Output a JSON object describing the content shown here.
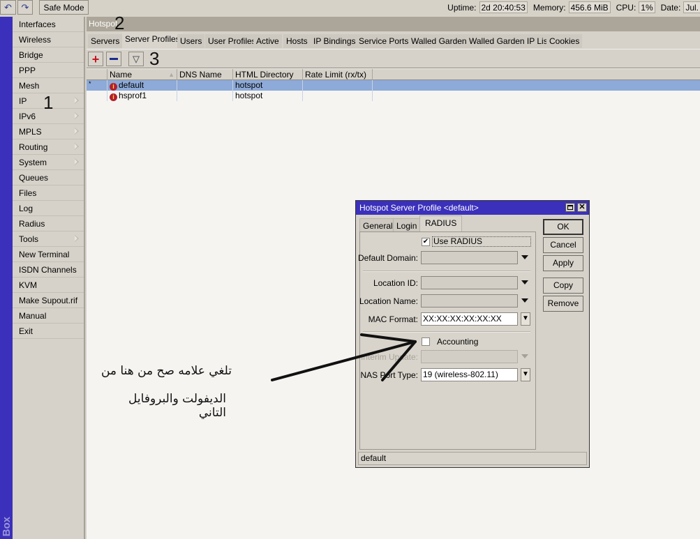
{
  "toolbar": {
    "undo_icon": "undo-icon",
    "redo_icon": "redo-icon",
    "safe_mode_label": "Safe Mode"
  },
  "status": {
    "uptime_label": "Uptime:",
    "uptime_value": "2d 20:40:53",
    "memory_label": "Memory:",
    "memory_value": "456.6 MiB",
    "cpu_label": "CPU:",
    "cpu_value": "1%",
    "date_label": "Date:",
    "date_value": "Jul."
  },
  "brand_strip_text": "Box",
  "sidebar": {
    "items": [
      {
        "label": "Interfaces",
        "submenu": false
      },
      {
        "label": "Wireless",
        "submenu": false
      },
      {
        "label": "Bridge",
        "submenu": false
      },
      {
        "label": "PPP",
        "submenu": false
      },
      {
        "label": "Mesh",
        "submenu": false
      },
      {
        "label": "IP",
        "submenu": true
      },
      {
        "label": "IPv6",
        "submenu": true
      },
      {
        "label": "MPLS",
        "submenu": true
      },
      {
        "label": "Routing",
        "submenu": true
      },
      {
        "label": "System",
        "submenu": true
      },
      {
        "label": "Queues",
        "submenu": false
      },
      {
        "label": "Files",
        "submenu": false
      },
      {
        "label": "Log",
        "submenu": false
      },
      {
        "label": "Radius",
        "submenu": false
      },
      {
        "label": "Tools",
        "submenu": true
      },
      {
        "label": "New Terminal",
        "submenu": false
      },
      {
        "label": "ISDN Channels",
        "submenu": false
      },
      {
        "label": "KVM",
        "submenu": false
      },
      {
        "label": "Make Supout.rif",
        "submenu": false
      },
      {
        "label": "Manual",
        "submenu": false
      },
      {
        "label": "Exit",
        "submenu": false
      }
    ]
  },
  "annotations": {
    "one": "1",
    "two": "2",
    "three": "3"
  },
  "window": {
    "title": "Hotspot",
    "tabs": [
      "Servers",
      "Server Profiles",
      "Users",
      "User Profiles",
      "Active",
      "Hosts",
      "IP Bindings",
      "Service Ports",
      "Walled Garden",
      "Walled Garden IP List",
      "Cookies"
    ],
    "active_tab": "Server Profiles",
    "tools": {
      "add": "add-icon",
      "remove": "remove-icon",
      "filter": "filter-icon"
    },
    "table": {
      "columns": [
        "Name",
        "DNS Name",
        "HTML Directory",
        "Rate Limit (rx/tx)"
      ],
      "rows": [
        {
          "flag": "*",
          "name": "default",
          "dns_name": "",
          "html_directory": "hotspot",
          "rate_limit": "",
          "selected": true
        },
        {
          "flag": "",
          "name": "hsprof1",
          "dns_name": "",
          "html_directory": "hotspot",
          "rate_limit": "",
          "selected": false
        }
      ]
    }
  },
  "dialog": {
    "title": "Hotspot Server Profile <default>",
    "tabs": [
      "General",
      "Login",
      "RADIUS"
    ],
    "active_tab": "RADIUS",
    "use_radius_label": "Use RADIUS",
    "use_radius_checked": true,
    "default_domain_label": "Default Domain:",
    "default_domain_value": "",
    "location_id_label": "Location ID:",
    "location_id_value": "",
    "location_name_label": "Location Name:",
    "location_name_value": "",
    "mac_format_label": "MAC Format:",
    "mac_format_value": "XX:XX:XX:XX:XX:XX",
    "accounting_label": "Accounting",
    "accounting_checked": false,
    "interim_update_label": "Interim Update:",
    "interim_update_value": "",
    "nas_port_type_label": "NAS Port Type:",
    "nas_port_type_value": "19 (wireless-802.11)",
    "buttons": {
      "ok": "OK",
      "cancel": "Cancel",
      "apply": "Apply",
      "copy": "Copy",
      "remove": "Remove"
    },
    "status_text": "default"
  },
  "instruction_text": {
    "line1": "تلغي علامه صح من هنا من",
    "line2": "الديفولت والبروفايل التاني"
  }
}
